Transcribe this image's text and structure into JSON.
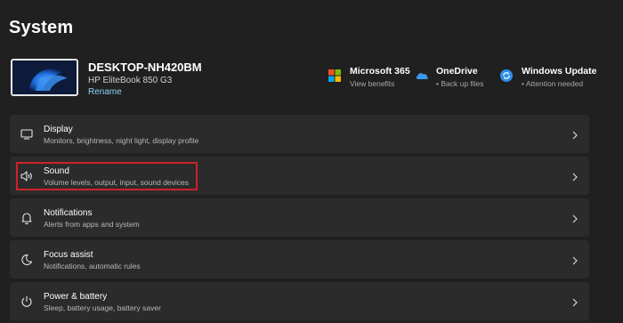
{
  "page": {
    "title": "System"
  },
  "device": {
    "name": "DESKTOP-NH420BM",
    "model": "HP EliteBook 850 G3",
    "rename_label": "Rename"
  },
  "quick_links": [
    {
      "title": "Microsoft 365",
      "subtitle": "View benefits",
      "icon": "microsoft-365-icon"
    },
    {
      "title": "OneDrive",
      "subtitle": "• Back up files",
      "icon": "onedrive-icon"
    },
    {
      "title": "Windows Update",
      "subtitle": "• Attention needed",
      "icon": "windows-update-icon"
    }
  ],
  "settings": [
    {
      "title": "Display",
      "subtitle": "Monitors, brightness, night light, display profile",
      "icon": "display-icon"
    },
    {
      "title": "Sound",
      "subtitle": "Volume levels, output, input, sound devices",
      "icon": "speaker-icon"
    },
    {
      "title": "Notifications",
      "subtitle": "Alerts from apps and system",
      "icon": "bell-icon"
    },
    {
      "title": "Focus assist",
      "subtitle": "Notifications, automatic rules",
      "icon": "moon-icon"
    },
    {
      "title": "Power & battery",
      "subtitle": "Sleep, battery usage, battery saver",
      "icon": "power-icon"
    }
  ],
  "colors": {
    "background": "#202020",
    "card": "#2b2b2b",
    "accent_link": "#8fd0f5",
    "highlight": "#d0202a"
  }
}
